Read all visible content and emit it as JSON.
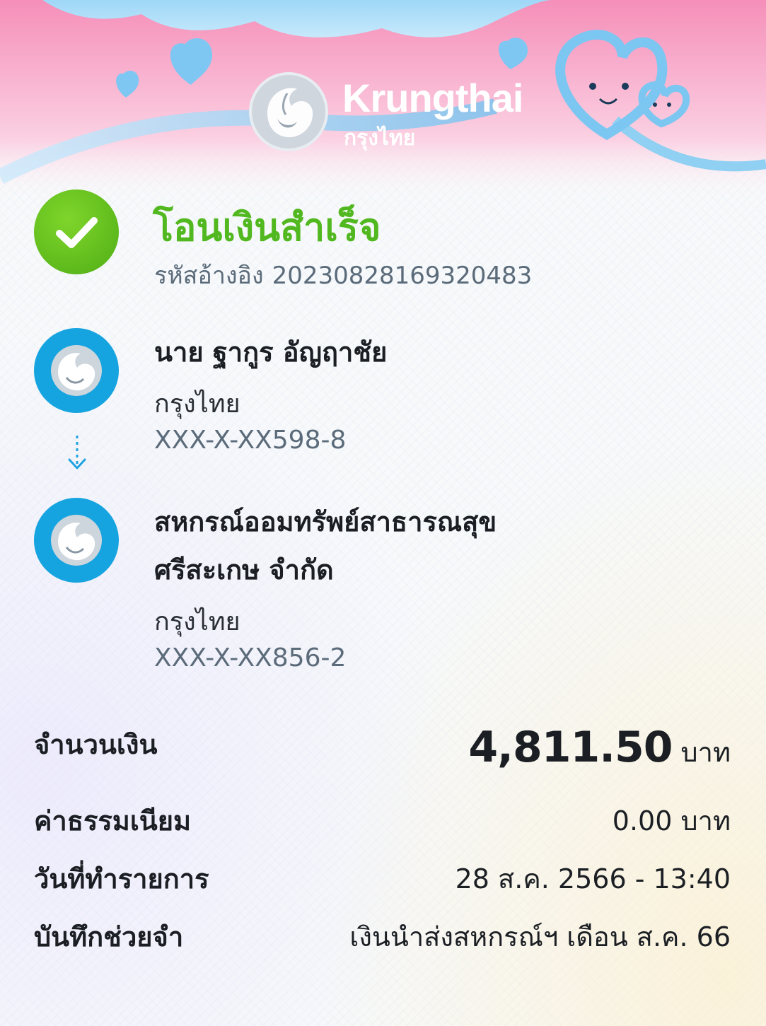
{
  "brand": {
    "name": "Krungthai",
    "name_thai": "กรุงไทย"
  },
  "status": {
    "title": "โอนเงินสำเร็จ",
    "ref_label": "รหัสอ้างอิง",
    "ref_value": "20230828169320483",
    "icon": "check-icon"
  },
  "sender": {
    "name": "นาย ฐากูร อัญฤาชัย",
    "bank": "กรุงไทย",
    "account": "XXX-X-XX598-8",
    "icon": "krungthai-logo-icon"
  },
  "receiver": {
    "name_line1": "สหกรณ์ออมทรัพย์สาธารณสุข",
    "name_line2": "ศรีสะเกษ จำกัด",
    "bank": "กรุงไทย",
    "account": "XXX-X-XX856-2",
    "icon": "krungthai-logo-icon"
  },
  "details": {
    "amount_label": "จำนวนเงิน",
    "amount_value": "4,811.50",
    "amount_unit": "บาท",
    "fee_label": "ค่าธรรมเนียม",
    "fee_value": "0.00 บาท",
    "date_label": "วันที่ทำรายการ",
    "date_value": "28 ส.ค. 2566 - 13:40",
    "memo_label": "บันทึกช่วยจำ",
    "memo_value": "เงินนำส่งสหกรณ์ฯ เดือน ส.ค. 66"
  },
  "colors": {
    "success": "#52b81f",
    "brand_blue": "#16a4e0",
    "banner_pink": "#f7a6c6",
    "banner_sky": "#8ad0f5"
  }
}
